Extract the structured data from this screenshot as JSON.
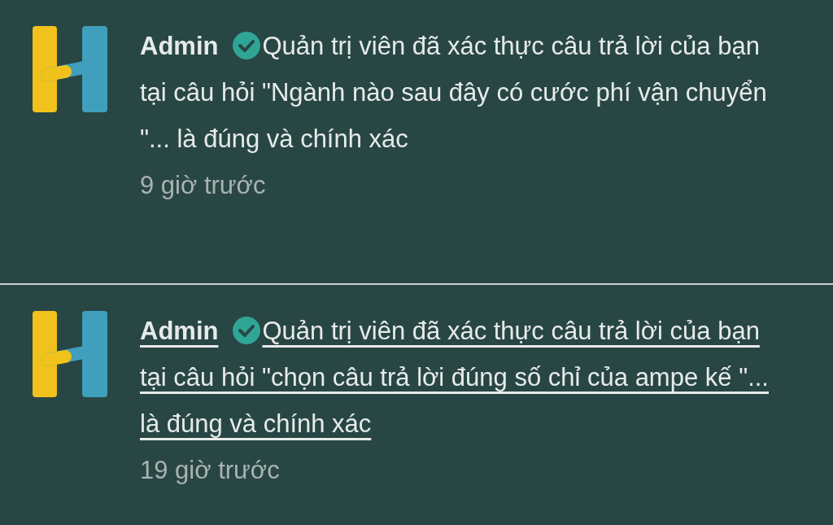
{
  "notifications": [
    {
      "author": "Admin",
      "verified": true,
      "message": "Quản trị viên đã xác thực câu trả lời của bạn tại câu hỏi \"Ngành nào sau đây có cước phí vận chuyển \"... là đúng và chính xác",
      "time": "9 giờ trước",
      "hovered": false
    },
    {
      "author": "Admin",
      "verified": true,
      "message": "Quản trị viên đã xác thực câu trả lời của bạn tại câu hỏi \"chọn câu trả lời đúng số chỉ của ampe kế \"... là đúng và chính xác",
      "time": "19 giờ trước",
      "hovered": true
    }
  ]
}
